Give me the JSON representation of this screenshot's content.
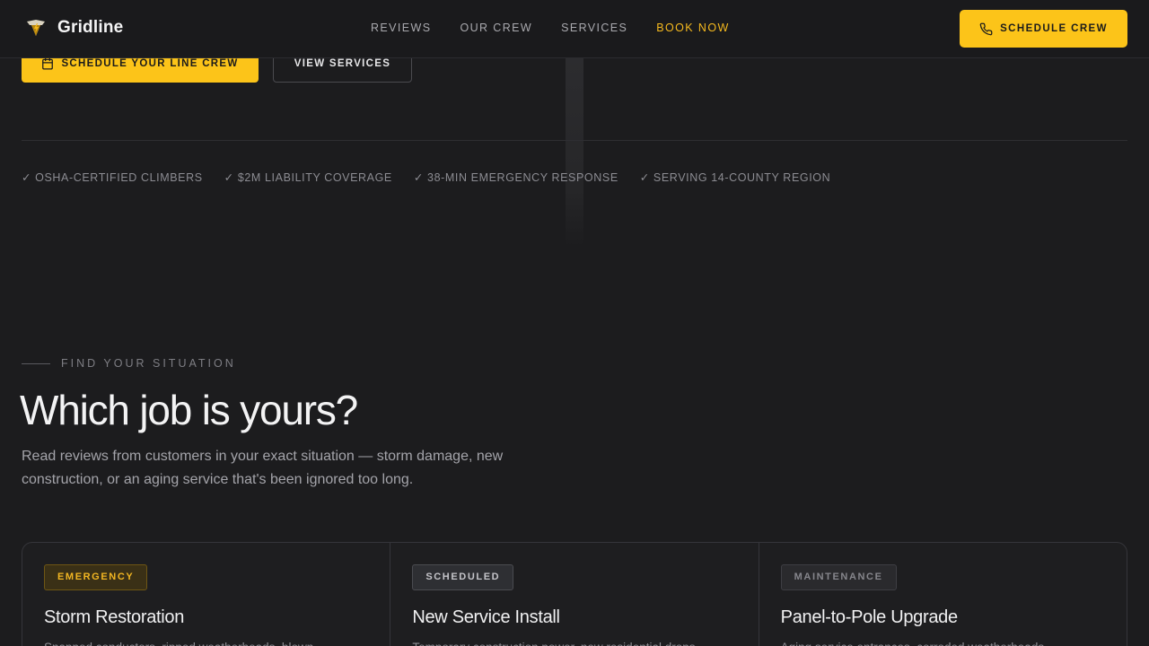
{
  "brand": {
    "name": "Gridline"
  },
  "nav": {
    "items": [
      {
        "label": "REVIEWS"
      },
      {
        "label": "OUR CREW"
      },
      {
        "label": "SERVICES"
      },
      {
        "label": "BOOK NOW"
      }
    ]
  },
  "header": {
    "cta_label": "SCHEDULE CREW"
  },
  "hero": {
    "primary_cta": "SCHEDULE YOUR LINE CREW",
    "secondary_cta": "VIEW SERVICES",
    "trust": [
      "✓ OSHA-CERTIFIED CLIMBERS",
      "✓ $2M LIABILITY COVERAGE",
      "✓ 38-MIN EMERGENCY RESPONSE",
      "✓ SERVING 14-COUNTY REGION"
    ]
  },
  "section": {
    "eyebrow": "FIND YOUR SITUATION",
    "title": "Which job is yours?",
    "lead": "Read reviews from customers in your exact situation — storm damage, new construction, or an aging service that's been ignored too long.",
    "cards": [
      {
        "badge": "EMERGENCY",
        "title": "Storm Restoration",
        "desc": "Snapped conductors, ripped weatherheads, blown"
      },
      {
        "badge": "SCHEDULED",
        "title": "New Service Install",
        "desc": "Temporary construction power, new residential drops"
      },
      {
        "badge": "MAINTENANCE",
        "title": "Panel-to-Pole Upgrade",
        "desc": "Aging service entrances, corroded weatherheads"
      }
    ]
  },
  "colors": {
    "accent": "#fcc419",
    "background": "#1c1c1e"
  },
  "icons": {
    "logo": "shield-bolt-icon",
    "phone": "phone-icon",
    "calendar": "calendar-icon"
  }
}
